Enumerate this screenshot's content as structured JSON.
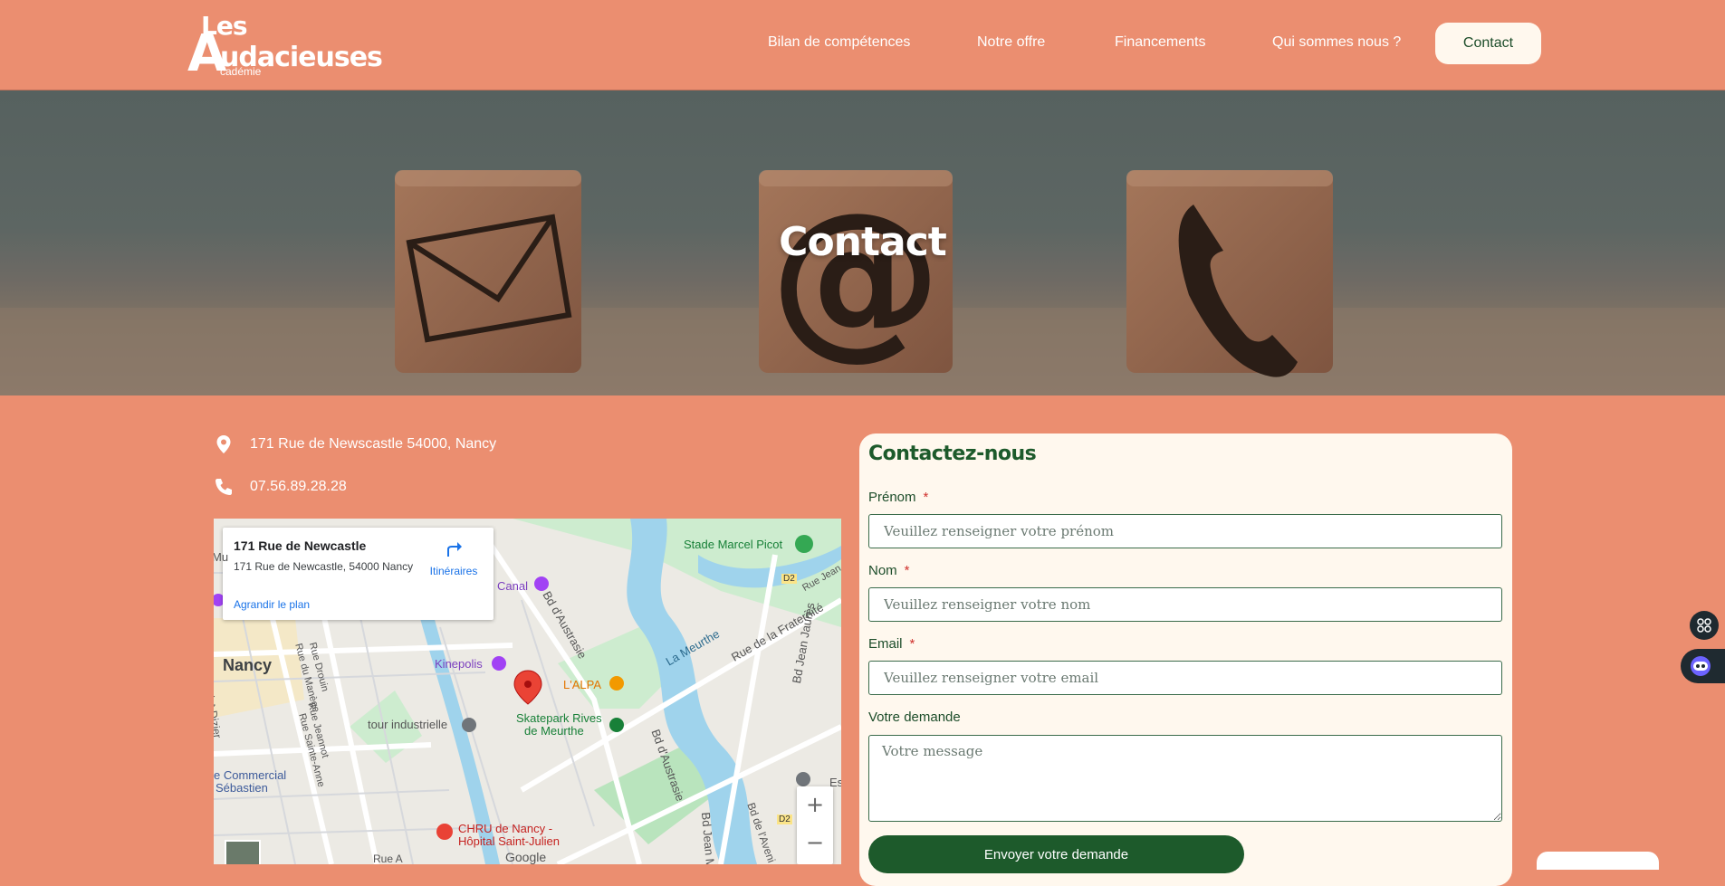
{
  "brand": {
    "line1": "Les",
    "initial": "A",
    "line2": "udacieuses",
    "line3": "cadémie"
  },
  "nav": {
    "items": [
      {
        "label": "Bilan de compétences"
      },
      {
        "label": "Notre offre"
      },
      {
        "label": "Financements"
      },
      {
        "label": "Qui sommes nous ?"
      }
    ],
    "cta": "Contact"
  },
  "hero": {
    "title": "Contact"
  },
  "contact_info": {
    "address": "171 Rue de Newscastle 54000, Nancy",
    "phone": "07.56.89.28.28"
  },
  "map": {
    "card_title": "171 Rue de Newcastle",
    "card_address": "171 Rue de Newcastle, 54000 Nancy",
    "card_link": "Agrandir le plan",
    "directions": "Itinéraires",
    "labels": {
      "stade": "Stade Marcel Picot",
      "canal": "Canal",
      "d2a": "D2",
      "nancy": "Nancy",
      "kinepolis": "Kinepolis",
      "alpa": "L'ALPA",
      "meurthe": "La Meurthe",
      "fraternite": "Rue de la Fraternité",
      "austrasie": "Bd d'Austrasie",
      "jeanjaures": "Bd Jean Jaurès",
      "tour": "tour industrielle",
      "skatepark1": "Skatepark Rives",
      "skatepark2": "de Meurthe",
      "commercial1": "e Commercial",
      "commercial2": "Sébastien",
      "chru1": "CHRU de Nancy -",
      "chru2": "Hôpital Saint-Julien",
      "google": "Google",
      "drouin": "Rue Drouin",
      "manege": "Rue du Manège",
      "jeannot": "Rue Jeannot",
      "sainteanne": "Rue Sainte-Anne",
      "stdizier": "Saint-Dizier",
      "ruea": "Rue A",
      "es": "Es",
      "d2b": "D2",
      "austrasie2": "Bd d'Austrasie",
      "jeanm": "Bd Jean M",
      "avenir": "Bd de l'Aveni",
      "ruejean": "Rue Jean",
      "mu": "Mu",
      "ru": "Ru",
      "b": "B",
      "canalhidden": ""
    },
    "zoom_in": "+",
    "zoom_out": "−"
  },
  "form": {
    "title": "Contactez-nous",
    "required_mark": "*",
    "fields": {
      "prenom": {
        "label": "Prénom",
        "placeholder": "Veuillez renseigner votre prénom"
      },
      "nom": {
        "label": "Nom",
        "placeholder": "Veuillez renseigner votre nom"
      },
      "email": {
        "label": "Email",
        "placeholder": "Veuillez renseigner votre email"
      },
      "demande": {
        "label": "Votre demande",
        "placeholder": "Votre message"
      }
    },
    "submit": "Envoyer votre demande"
  },
  "colors": {
    "background": "#eb8e70",
    "brand_green": "#1d5a2b",
    "cream": "#fff8ee",
    "required": "#d0312d"
  },
  "icons": {
    "address": "location-pin-icon",
    "phone": "phone-icon",
    "directions": "directions-arrow-icon",
    "widget": "grid-icon",
    "chatbot": "robot-icon"
  }
}
